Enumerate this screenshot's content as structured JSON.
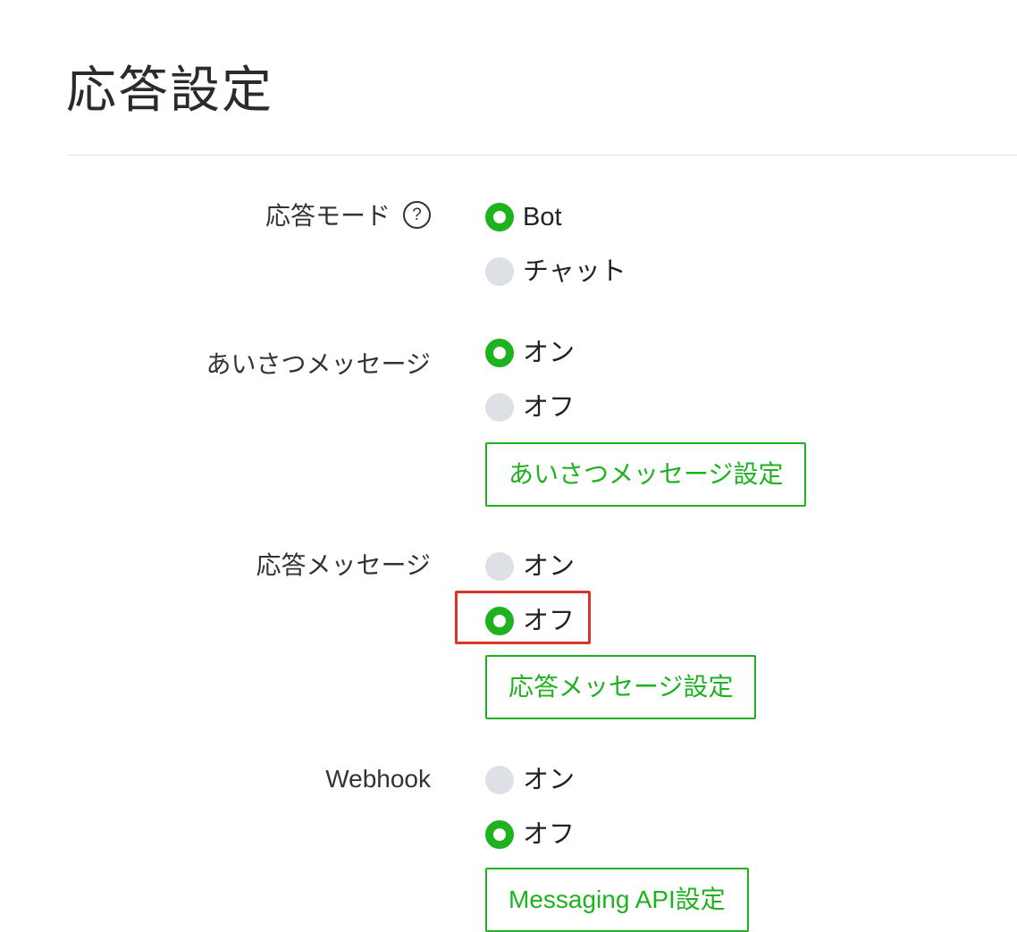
{
  "page": {
    "title": "応答設定"
  },
  "response_mode": {
    "label": "応答モード",
    "help_icon": "?",
    "options": [
      {
        "label": "Bot",
        "selected": true
      },
      {
        "label": "チャット",
        "selected": false
      }
    ]
  },
  "greeting_message": {
    "label": "あいさつメッセージ",
    "options": [
      {
        "label": "オン",
        "selected": true
      },
      {
        "label": "オフ",
        "selected": false
      }
    ],
    "button": "あいさつメッセージ設定"
  },
  "auto_response": {
    "label": "応答メッセージ",
    "options": [
      {
        "label": "オン",
        "selected": false
      },
      {
        "label": "オフ",
        "selected": true
      }
    ],
    "button": "応答メッセージ設定"
  },
  "webhook": {
    "label": "Webhook",
    "options": [
      {
        "label": "オン",
        "selected": false
      },
      {
        "label": "オフ",
        "selected": true
      }
    ],
    "button": "Messaging API設定"
  },
  "colors": {
    "accent": "#1fb21f",
    "unselected_radio": "#dde0e4",
    "highlight": "#d9332b",
    "divider": "#e3e5e8"
  }
}
